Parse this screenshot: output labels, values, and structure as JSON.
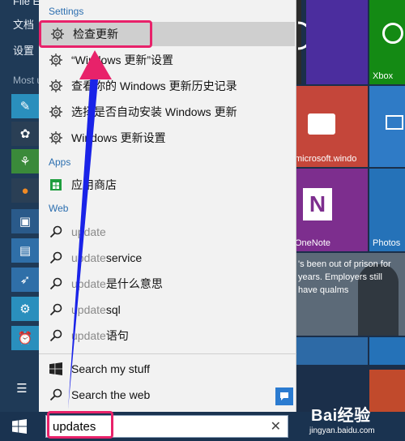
{
  "start_menu": {
    "items": [
      "文档",
      "设置"
    ],
    "most_used_label": "Most u"
  },
  "popup": {
    "settings_header": "Settings",
    "settings": [
      {
        "text": "检查更新"
      },
      {
        "text": "“Windows 更新”设置"
      },
      {
        "text": "查看你的 Windows 更新历史记录"
      },
      {
        "text": "选择是否自动安装 Windows 更新"
      },
      {
        "text": "Windows 更新设置"
      }
    ],
    "apps_header": "Apps",
    "apps": [
      {
        "text": "应用商店"
      }
    ],
    "web_header": "Web",
    "web": [
      {
        "query": "update",
        "rest": ""
      },
      {
        "query": "update",
        "rest": " service"
      },
      {
        "query": "update",
        "rest": "是什么意思"
      },
      {
        "query": "update",
        "rest": " sql"
      },
      {
        "query": "update",
        "rest": "语句"
      }
    ],
    "search_my_stuff": "Search my stuff",
    "search_web": "Search the web"
  },
  "taskbar": {
    "search_value": "updates",
    "clear_glyph": "✕"
  },
  "tiles": {
    "xbox": "Xbox",
    "msn": "microsoft.windo",
    "onenote": "OneNote",
    "photos": "Photos",
    "news": "'s been out of prison for years. Employers still have qualms"
  },
  "watermark": {
    "brand": "Bai经验",
    "url": "jingyan.baidu.com"
  },
  "colors": {
    "highlight": "#e8226a",
    "arrow": "#1a23e8"
  }
}
